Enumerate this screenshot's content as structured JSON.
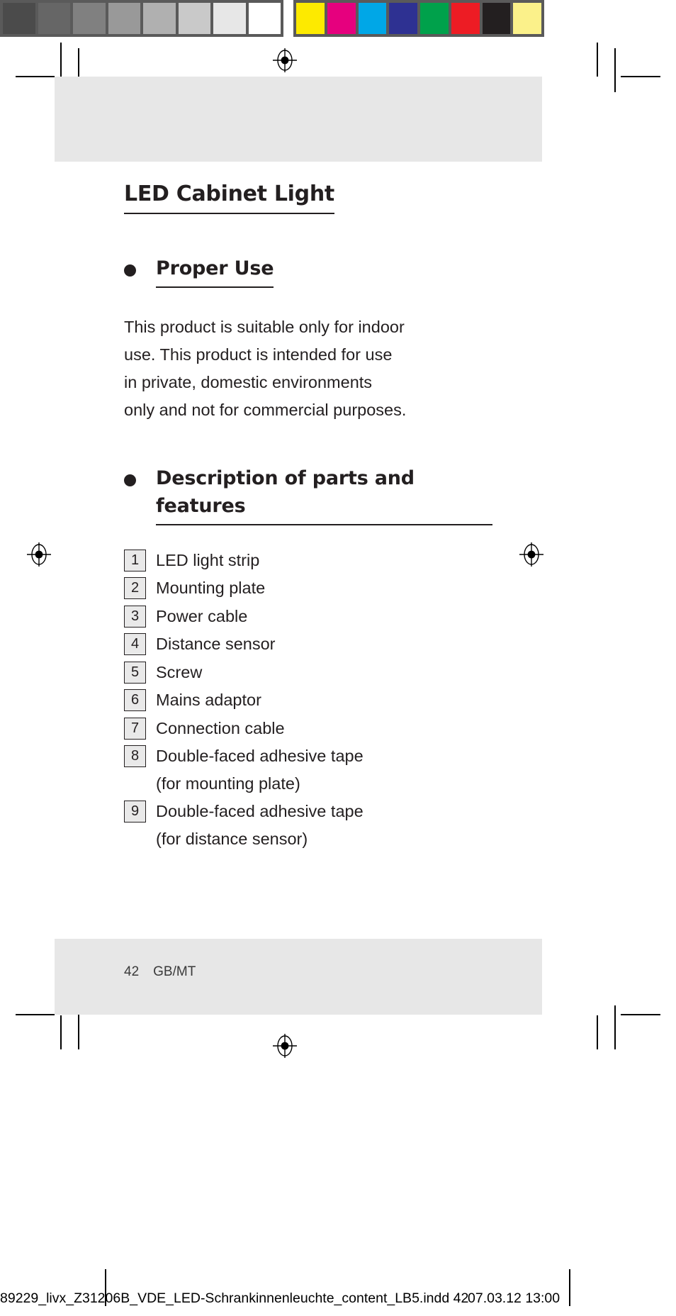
{
  "calibration": {
    "grayscale_patches": [
      "#4b4b4b",
      "#666666",
      "#808080",
      "#999999",
      "#b0b0b0",
      "#c9c9c9",
      "#e7e7e7",
      "#ffffff"
    ],
    "color_patches": [
      "#fdea00",
      "#e6007e",
      "#00a7e7",
      "#2e3192",
      "#00a14b",
      "#ed1c24",
      "#231f20",
      "#fbf18a"
    ],
    "bar_background": "#5a5a5a"
  },
  "document": {
    "title": "LED Cabinet Light",
    "sections": [
      {
        "bullet": "filled-disc",
        "heading": "Proper Use",
        "body": "This product is suitable only for indoor\nuse. This product is intended for use\nin private, domestic environments\nonly and not for commercial purposes."
      },
      {
        "bullet": "filled-disc",
        "heading": "Description of parts\nand features"
      }
    ],
    "parts_list": [
      {
        "number": "1",
        "label": "LED light strip"
      },
      {
        "number": "2",
        "label": "Mounting plate"
      },
      {
        "number": "3",
        "label": "Power cable"
      },
      {
        "number": "4",
        "label": "Distance sensor"
      },
      {
        "number": "5",
        "label": "Screw"
      },
      {
        "number": "6",
        "label": "Mains adaptor"
      },
      {
        "number": "7",
        "label": "Connection cable"
      },
      {
        "number": "8",
        "label": "Double-faced adhesive tape\n(for mounting plate)"
      },
      {
        "number": "9",
        "label": "Double-faced adhesive tape\n(for distance sensor)"
      }
    ],
    "footer": {
      "page_number": "42",
      "locale": "GB/MT"
    }
  },
  "imprint": {
    "filename": "89229_livx_Z31206B_VDE_LED-Schrankinnenleuchte_content_LB5.indd   42",
    "datestamp": "07.03.12 13:00"
  }
}
